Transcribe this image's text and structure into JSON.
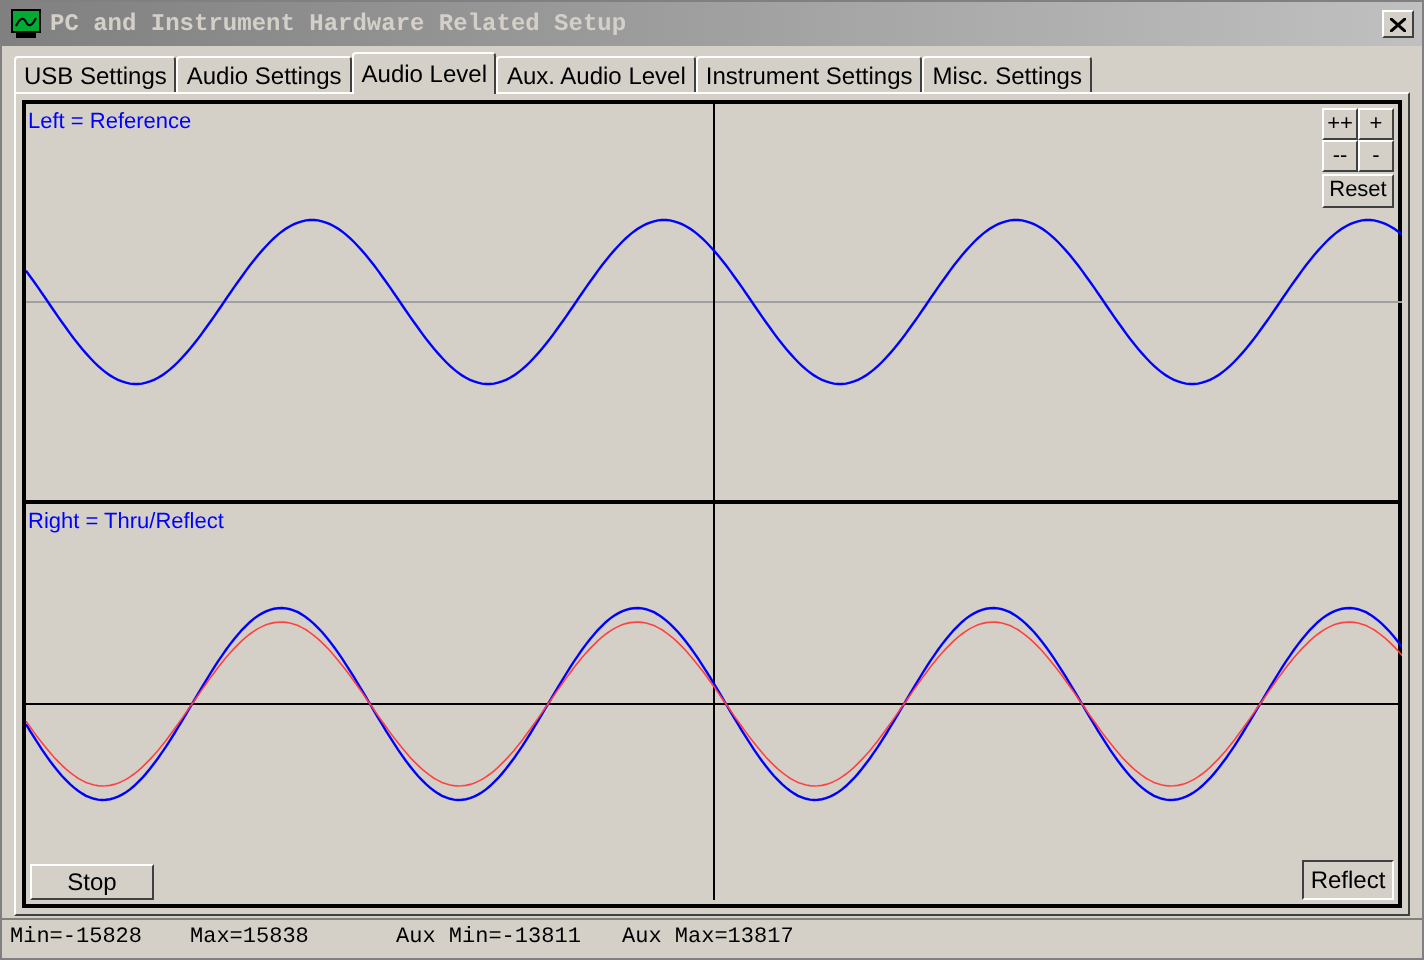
{
  "window": {
    "title": "PC and Instrument Hardware Related Setup"
  },
  "tabs": [
    {
      "label": "USB Settings",
      "selected": false
    },
    {
      "label": "Audio Settings",
      "selected": false
    },
    {
      "label": "Audio Level",
      "selected": true
    },
    {
      "label": "Aux. Audio Level",
      "selected": false
    },
    {
      "label": "Instrument Settings",
      "selected": false
    },
    {
      "label": "Misc. Settings",
      "selected": false
    }
  ],
  "top_plot": {
    "label": "Left = Reference",
    "zoom_buttons": [
      "++",
      "+",
      "--",
      "-"
    ],
    "reset_button": "Reset"
  },
  "bottom_plot": {
    "label": "Right = Thru/Reflect",
    "stop_button": "Stop",
    "reflect_button": {
      "label": "Reflect",
      "pressed": true
    }
  },
  "status_bar": [
    "Min=-15828",
    "Max=15838",
    "Aux Min=-13811",
    "Aux Max=13817"
  ]
}
